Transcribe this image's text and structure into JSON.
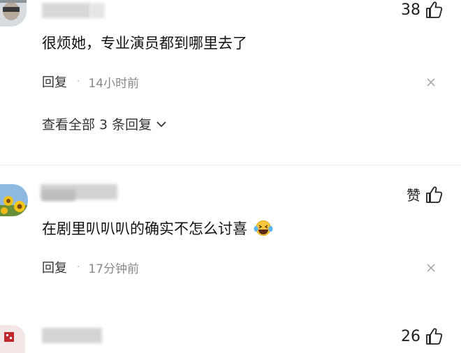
{
  "comments": [
    {
      "likes": "38",
      "text": "很烦她，专业演员都到哪里去了",
      "reply_label": "回复",
      "separator": "·",
      "time": "14小时前",
      "view_all": "查看全部 3 条回复"
    },
    {
      "likes": "赞",
      "text": "在剧里叭叭叭的确实不怎么讨喜",
      "reply_label": "回复",
      "separator": "·",
      "time": "17分钟前"
    },
    {
      "likes": "26"
    }
  ]
}
